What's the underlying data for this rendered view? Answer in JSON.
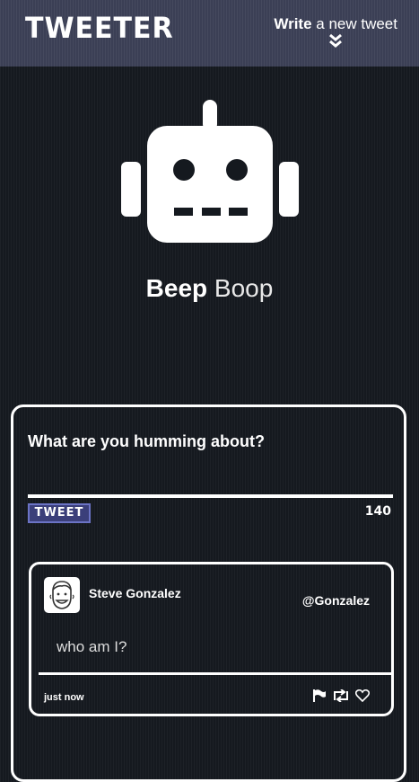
{
  "nav": {
    "brand": "TWEETER",
    "compose_bold": "Write",
    "compose_rest": " a new tweet",
    "chevron_icon": "double-chevron-down"
  },
  "profile": {
    "avatar_icon": "robot-icon",
    "first_name": "Beep",
    "last_name": "Boop"
  },
  "composer": {
    "prompt": "What are you humming about?",
    "textarea_value": "",
    "tweet_button": "TWEET",
    "char_count": "140"
  },
  "tweets": [
    {
      "avatar_icon": "face-avatar-icon",
      "name": "Steve Gonzalez",
      "handle": "@Gonzalez",
      "text": "who am I?",
      "time": "just now",
      "actions": [
        "flag-icon",
        "retweet-icon",
        "heart-icon"
      ]
    }
  ],
  "colors": {
    "background": "#15191f",
    "nav": "#3b3f55",
    "button": "#3b3f7a",
    "text": "#ffffff"
  }
}
